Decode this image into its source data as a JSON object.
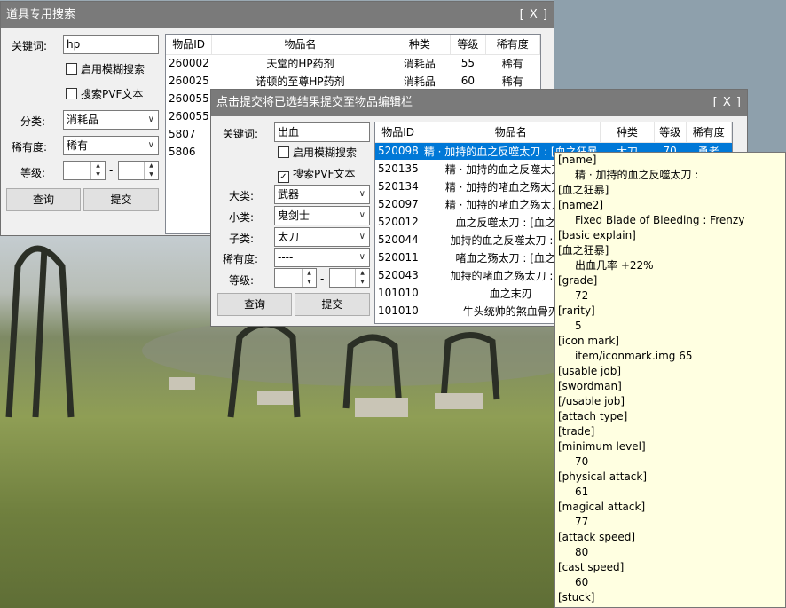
{
  "win1": {
    "title": "道具专用搜索",
    "close": "[ X ]",
    "keyword_label": "关键词:",
    "keyword_value": "hp",
    "fuzzy_label": "启用模糊搜索",
    "pvf_label": "搜索PVF文本",
    "category_label": "分类:",
    "category_value": "消耗品",
    "rarity_label": "稀有度:",
    "rarity_value": "稀有",
    "level_label": "等级:",
    "level_sep": "-",
    "query_button": "查询",
    "submit_button": "提交",
    "headers": [
      "物品ID",
      "物品名",
      "种类",
      "等级",
      "稀有度"
    ],
    "rows": [
      [
        "260002",
        "天堂的HP药剂",
        "消耗品",
        "55",
        "稀有"
      ],
      [
        "260025",
        "诺顿的至尊HP药剂",
        "消耗品",
        "60",
        "稀有"
      ],
      [
        "260055",
        "",
        "",
        "",
        ""
      ],
      [
        "260055",
        "",
        "",
        "",
        ""
      ],
      [
        "5807",
        "",
        "",
        "",
        ""
      ],
      [
        "5806",
        "",
        "",
        "",
        ""
      ]
    ]
  },
  "win2": {
    "title": "点击提交将已选结果提交至物品编辑栏",
    "close": "[ X ]",
    "keyword_label": "关键词:",
    "keyword_value": "出血",
    "fuzzy_label": "启用模糊搜索",
    "pvf_label": "搜索PVF文本",
    "pvf_checked": true,
    "major_label": "大类:",
    "major_value": "武器",
    "minor_label": "小类:",
    "minor_value": "鬼剑士",
    "sub_label": "子类:",
    "sub_value": "太刀",
    "rarity_label": "稀有度:",
    "rarity_value": "----",
    "level_label": "等级:",
    "level_sep": "-",
    "query_button": "查询",
    "submit_button": "提交",
    "headers": [
      "物品ID",
      "物品名",
      "种类",
      "等级",
      "稀有度"
    ],
    "rows": [
      [
        "520098",
        "精 · 加持的血之反噬太刀 : [血之狂暴",
        "太刀",
        "70",
        "勇者"
      ],
      [
        "520135",
        "精 · 加持的血之反噬太刀 : [",
        "",
        "",
        ""
      ],
      [
        "520134",
        "精 · 加持的啫血之殇太刀 : [",
        "",
        "",
        ""
      ],
      [
        "520097",
        "精 · 加持的啫血之殇太刀 : [",
        "",
        "",
        ""
      ],
      [
        "520012",
        "血之反噬太刀 : [血之狂",
        "",
        "",
        ""
      ],
      [
        "520044",
        "加持的血之反噬太刀 : [血",
        "",
        "",
        ""
      ],
      [
        "520011",
        "啫血之殇太刀 : [血之狂",
        "",
        "",
        ""
      ],
      [
        "520043",
        "加持的啫血之殇太刀 : [血",
        "",
        "",
        ""
      ],
      [
        "101010",
        "血之末刃",
        "",
        "",
        ""
      ],
      [
        "101010",
        "牛头统帅的煞血骨刃",
        "",
        "",
        ""
      ]
    ]
  },
  "tooltip": [
    {
      "t": "[name]",
      "i": false
    },
    {
      "t": "精 · 加持的血之反噬太刀 :",
      "i": true
    },
    {
      "t": "[血之狂暴]",
      "i": false
    },
    {
      "t": "[name2]",
      "i": false
    },
    {
      "t": "Fixed Blade of Bleeding : Frenzy",
      "i": true
    },
    {
      "t": "[basic explain]",
      "i": false
    },
    {
      "t": "[血之狂暴]",
      "i": false
    },
    {
      "t": "出血几率 +22%",
      "i": true
    },
    {
      "t": "[grade]",
      "i": false
    },
    {
      "t": "72",
      "i": true
    },
    {
      "t": "[rarity]",
      "i": false
    },
    {
      "t": "5",
      "i": true
    },
    {
      "t": "[icon mark]",
      "i": false
    },
    {
      "t": "item/iconmark.img 65",
      "i": true
    },
    {
      "t": "[usable job]",
      "i": false
    },
    {
      "t": "[swordman]",
      "i": false
    },
    {
      "t": "[/usable job]",
      "i": false
    },
    {
      "t": "[attach type]",
      "i": false
    },
    {
      "t": "[trade]",
      "i": false
    },
    {
      "t": "[minimum level]",
      "i": false
    },
    {
      "t": "70",
      "i": true
    },
    {
      "t": "[physical attack]",
      "i": false
    },
    {
      "t": "61",
      "i": true
    },
    {
      "t": "[magical attack]",
      "i": false
    },
    {
      "t": "77",
      "i": true
    },
    {
      "t": "[attack speed]",
      "i": false
    },
    {
      "t": "80",
      "i": true
    },
    {
      "t": "[cast speed]",
      "i": false
    },
    {
      "t": "60",
      "i": true
    },
    {
      "t": "[stuck]",
      "i": false
    }
  ]
}
